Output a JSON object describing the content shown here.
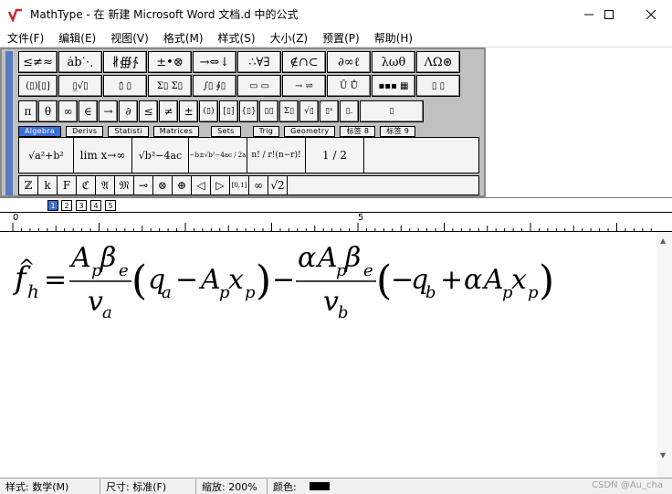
{
  "window": {
    "title": "MathType - 在 新建 Microsoft Word 文档.d 中的公式",
    "minimize_icon": "minimize-icon",
    "maximize_icon": "maximize-icon",
    "close_icon": "close-icon"
  },
  "menu": [
    {
      "label": "文件(F)"
    },
    {
      "label": "编辑(E)"
    },
    {
      "label": "视图(V)"
    },
    {
      "label": "格式(M)"
    },
    {
      "label": "样式(S)"
    },
    {
      "label": "大小(Z)"
    },
    {
      "label": "预置(P)"
    },
    {
      "label": "帮助(H)"
    }
  ],
  "toolbar": {
    "row1": [
      "≤≠≈",
      "ȧb⋱",
      "∦∰∱",
      "±•⊗",
      "→⇔↓",
      "∴∀∃",
      "∉∩⊂",
      "∂∞ℓ",
      "λωθ",
      "ΛΩ⊛"
    ],
    "row2": [
      "(▯)[▯]",
      "▯̲√▯",
      "▯̇ ▯",
      "Σ▯ Σ▯",
      "∫▯ ∮▯",
      "▭ ▭",
      "→ ⇌",
      "Ū Ů",
      "▪▪▪ ▦",
      "▯ ▯"
    ],
    "row3": [
      "π",
      "θ",
      "∞",
      "∈",
      "→",
      "∂",
      "≤",
      "≠",
      "±",
      "(▯)",
      "[▯]",
      "{▯}",
      "▯▯",
      "Σ▯",
      "√▯",
      "▯ˣ",
      "▯.",
      "▯"
    ],
    "tabs": [
      {
        "label": "Algebra",
        "active": true
      },
      {
        "label": "Derivs",
        "active": false
      },
      {
        "label": "Statisti",
        "active": false
      },
      {
        "label": "Matrices",
        "active": false
      },
      {
        "label": "Sets",
        "active": false
      },
      {
        "label": "Trig",
        "active": false
      },
      {
        "label": "Geometry",
        "active": false
      },
      {
        "label": "标签 8",
        "active": false
      },
      {
        "label": "标签 9",
        "active": false
      }
    ],
    "templates": [
      {
        "text": "√a²+b²"
      },
      {
        "text": "lim x→∞"
      },
      {
        "text": "√b²−4ac"
      },
      {
        "text": "−b±√b²−4ac / 2a"
      },
      {
        "text": "n! / r!(n−r)!"
      },
      {
        "text": "1 / 2"
      }
    ],
    "bottom": [
      "ℤ",
      "k",
      "F",
      "ℭ",
      "𝔄",
      "𝔐",
      "⊸",
      "⊗",
      "⊕",
      "◁",
      "▷",
      "[0,1]",
      "∞",
      "√2"
    ]
  },
  "size_buttons": [
    "1",
    "2",
    "3",
    "4",
    "5"
  ],
  "ruler": {
    "mark0": "0",
    "mark5": "5"
  },
  "equation": {
    "f": "f",
    "hat": "^",
    "h": "h",
    "eq": "=",
    "A": "A",
    "p": "p",
    "beta": "β",
    "e": "e",
    "v": "v",
    "a": "a",
    "q": "q",
    "x": "x",
    "minus": "−",
    "alpha": "α",
    "b": "b",
    "plus": "+",
    "lparen": "(",
    "rparen": ")"
  },
  "status": {
    "style": "样式: 数学(M)",
    "size": "尺寸: 标准(F)",
    "zoom": "缩放: 200%",
    "color_label": "颜色:",
    "color": "#000000"
  },
  "watermark": "CSDN @Au_cha"
}
